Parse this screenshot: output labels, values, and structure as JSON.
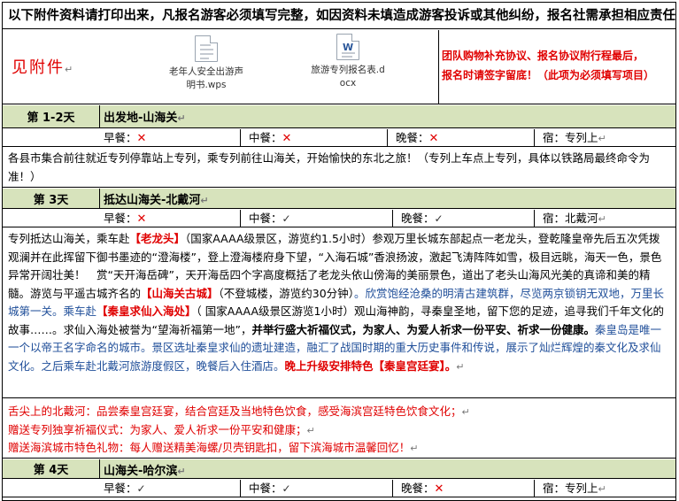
{
  "notice": "以下附件资料请打印出来，凡报名游客必须填写完整，如因资料未填造成游客投诉或其他纠纷，报名社需承担相应责任",
  "attachments": {
    "label": "见附件",
    "files": [
      {
        "name_line1": "老年人安全出游声",
        "name_line2": "明书.wps",
        "icon": "wps-document-icon"
      },
      {
        "name_line1": "旅游专列报名表.d",
        "name_line2": "ocx",
        "icon": "word-document-icon"
      }
    ],
    "note_line1": "团队购物补充协议、报名协议附行程最后，",
    "note_line2": "报名时请签字留底！（此项为必须填写项目）"
  },
  "return_mark": "↵",
  "meal_labels": {
    "breakfast": "早餐：",
    "lunch": "中餐：",
    "dinner": "晚餐：",
    "lodging": "宿："
  },
  "marks": {
    "no": "✕",
    "yes": "✓"
  },
  "days": [
    {
      "label": "第 1-2天",
      "title": "出发地-山海关",
      "breakfast": "no",
      "lunch": "no",
      "dinner": "no",
      "lodging": "专列上",
      "desc": "各县市集合前往就近专列停靠站上专列，乘专列前往山海关，开始愉快的东北之旅！（专列上车点上专列，具体以铁路局最终命令为准！）"
    },
    {
      "label": "第 3天",
      "title": "抵达山海关-北戴河",
      "breakfast": "no",
      "lunch": "yes",
      "dinner": "yes",
      "lodging": "北戴河",
      "desc": {
        "p1": "专列抵达山海关，乘车赴",
        "laolongtou": "【老龙头】",
        "p2": "（国家AAAA级景区，游览约1.5小时）参观万里长城东部起点一老龙头，登乾隆皇帝先后五次凭拨观澜并在此挥留下御书墨迹的“澄海楼”，登上澄海楼府身下望，“入海石城”香浪扬波，激起飞涛阵阵如雪，极目远眺，海天一色，景色异常开阔壮美！　赏“天开海岳碑”，天开海岳四个字高度概括了老龙头依山傍海的美丽景色，道出了老头山海风光美的真谛和美的精髓。游览与平遥古城齐名的",
        "gucheng": "【山海关古城】",
        "p3": "（不登城楼，游览约30分钟）",
        "p4": "。欣赏饱经沧桑的明清古建筑群，尽览两京锁钥无双地，万里长城第一关。乘车赴",
        "qinhuang": "【秦皇求仙入海处】",
        "p5": "（ 国家AAAA级景区游览1小时）观山海神韵，寻秦皇圣地，留下您的足迹，追寻我们千年文化的故事……。求仙入海处被誉为“望海祈福第一地”，",
        "p6": "并举行盛大祈福仪式，为家人、为爱人祈求一份平安、祈求一份健康。",
        "p7": "秦皇岛是唯一一个以帝王名字命名的城市。景区选址秦皇求仙的遗址建造，融汇了战国时期的重大历史事件和传说，展示了灿烂辉煌的秦文化及求仙文化。之后乘车赴北戴河旅游度假区，晚餐后入住酒店。",
        "p8": "晚上升级安排特色【秦皇宫廷宴】。"
      },
      "extras": [
        "舌尖上的北戴河：品尝秦皇宫廷宴，结合宫廷及当地特色饮食，感受海滨宫廷特色饮食文化；",
        "赠送专列独享祈福仪式：为家人、爱人祈求一份平安和健康；",
        "赠送海滨城市特色礼物：每人赠送精美海螺/贝壳钥匙扣，留下滨海城市温馨回忆！"
      ]
    },
    {
      "label": "第 4天",
      "title": "山海关-哈尔滨",
      "breakfast": "yes",
      "lunch": "yes",
      "dinner": "no",
      "lodging": "专列上"
    }
  ],
  "colors": {
    "accent_red": "#e00000",
    "day_header_bg": "#d7e3bc",
    "link_blue": "#1f4e99"
  }
}
